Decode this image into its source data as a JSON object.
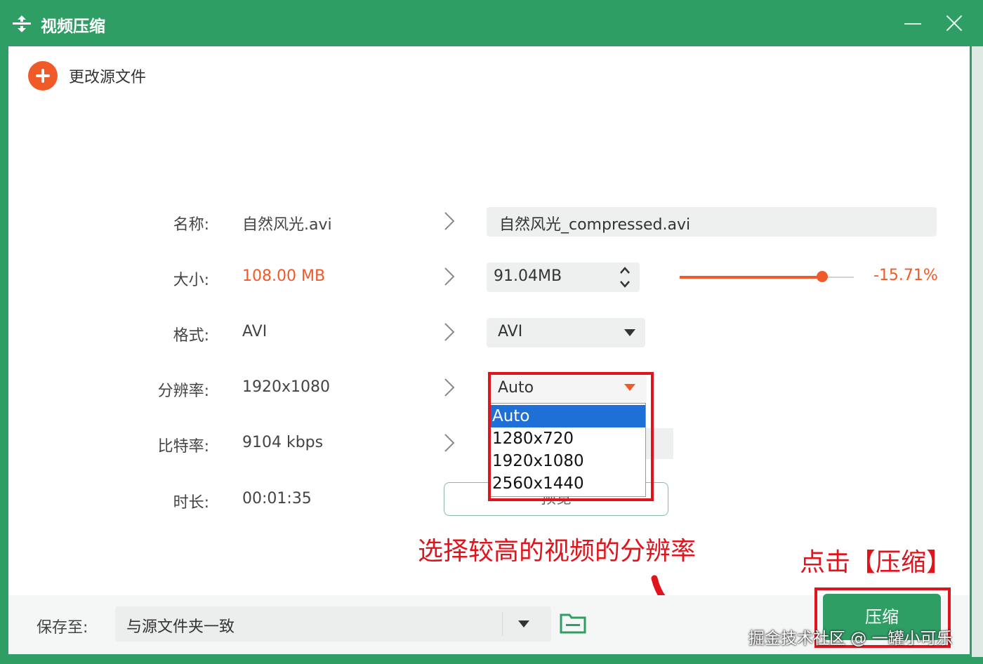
{
  "window": {
    "title": "视频压缩",
    "change_source_label": "更改源文件"
  },
  "labels": {
    "name": "名称:",
    "size": "大小:",
    "format": "格式:",
    "resolution": "分辨率:",
    "bitrate": "比特率:",
    "duration": "时长:"
  },
  "source": {
    "name": "自然风光.avi",
    "size": "108.00 MB",
    "format": "AVI",
    "resolution": "1920x1080",
    "bitrate": "9104 kbps",
    "duration": "00:01:35"
  },
  "output": {
    "name": "自然风光_compressed.avi",
    "size": "91.04MB",
    "compression_percent": "-15.71%",
    "slider_fraction": 0.82,
    "format": "AVI",
    "resolution": "Auto",
    "resolution_options": [
      "Auto",
      "1280x720",
      "1920x1080",
      "2560x1440"
    ],
    "resolution_selected": "Auto",
    "preview_label": "预览"
  },
  "footer": {
    "save_to_label": "保存至:",
    "save_to_value": "与源文件夹一致",
    "compress_label": "压缩"
  },
  "annotations": {
    "resolution_hint": "选择较高的视频的分辨率",
    "click_hint": "点击【压缩】"
  },
  "watermark": "掘金技术社区 @ 一罐小可乐",
  "colors": {
    "brand_green": "#2e9e64",
    "accent_orange": "#f05a28",
    "annotation_red": "#e0141c",
    "selection_blue": "#1e6fd6"
  },
  "icons": {
    "app": "compress-icon",
    "change_source": "plus-circle-icon",
    "folder": "folder-icon",
    "dropdown": "caret-down-icon",
    "spinner": "stepper-icon",
    "chevron": "chevron-right-icon"
  }
}
